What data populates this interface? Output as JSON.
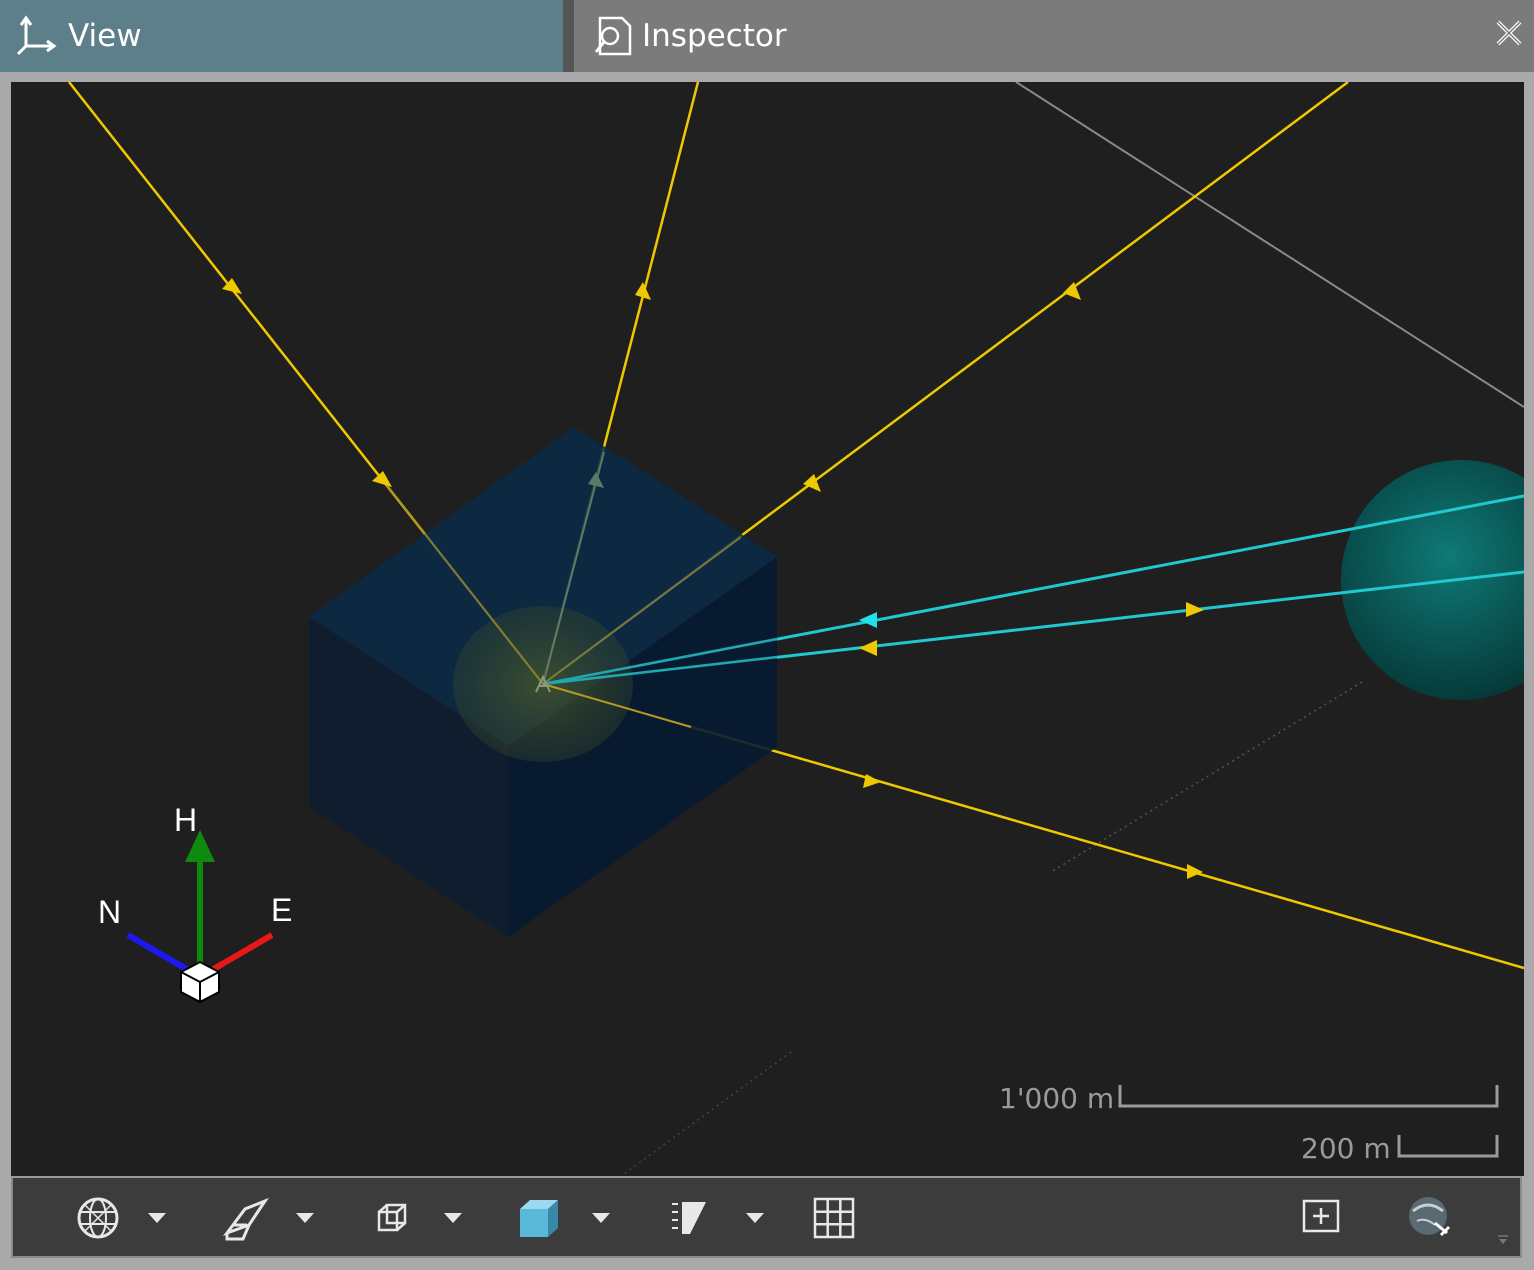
{
  "tabs": {
    "view_label": "View",
    "inspector_label": "Inspector"
  },
  "compass": {
    "h_label": "H",
    "n_label": "N",
    "e_label": "E"
  },
  "scale_bars": {
    "large_label": "1'000 m",
    "small_label": "200 m"
  },
  "toolbar": {
    "icons": [
      "globe-icon",
      "eraser-icon",
      "wireframe-cube-icon",
      "solid-cube-icon",
      "ruler-slice-icon",
      "grid-icon",
      "zoom-extents-icon",
      "reset-view-icon"
    ]
  },
  "colors": {
    "tab_active": "#5d7f8a",
    "viewport_bg": "#1f1f1f",
    "ray_yellow": "#f0c800",
    "ray_cyan": "#20c8d0",
    "box_blue": "#0b3a6e",
    "sphere_teal": "#0a6a66"
  }
}
